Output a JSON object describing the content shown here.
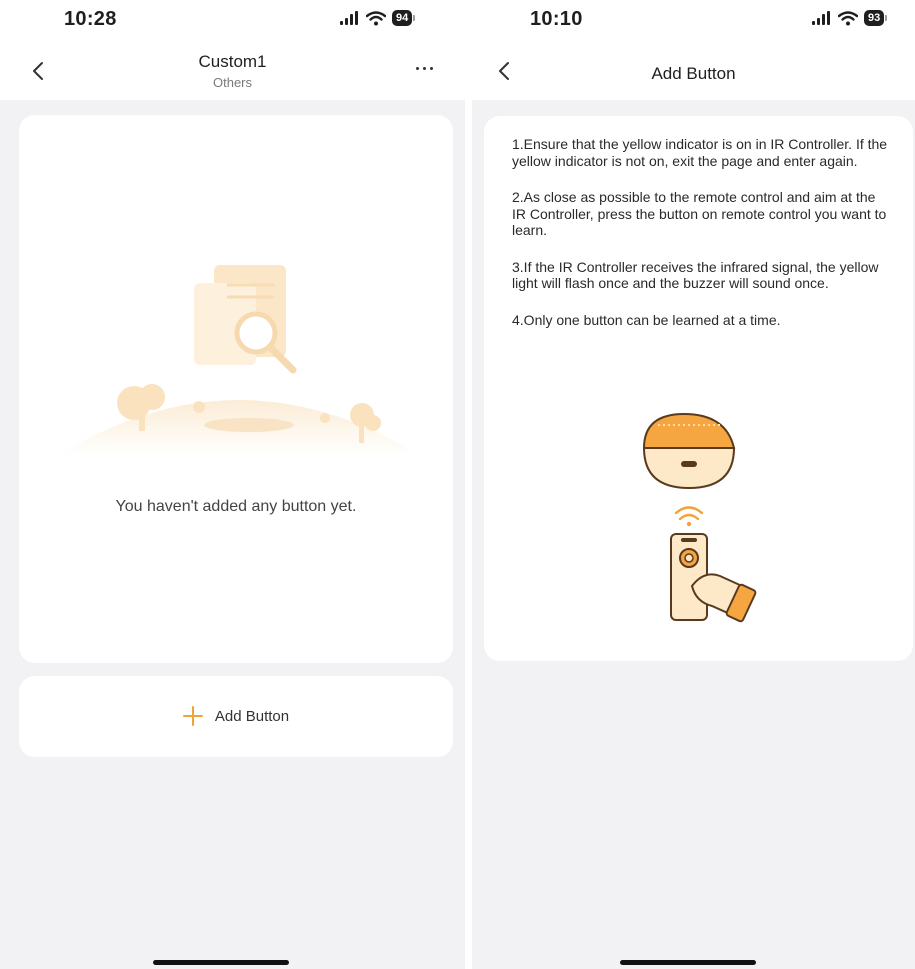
{
  "left": {
    "status": {
      "time": "10:28",
      "battery": "94"
    },
    "nav": {
      "title": "Custom1",
      "subtitle": "Others"
    },
    "empty_message": "You haven't added any button yet.",
    "add_button_label": "Add Button"
  },
  "right": {
    "status": {
      "time": "10:10",
      "battery": "93"
    },
    "nav": {
      "title": "Add Button"
    },
    "steps": [
      "1.Ensure that the yellow indicator is on in IR Controller. If the yellow indicator is not on, exit the page and enter again.",
      "2.As close as possible to the remote control and aim at the IR Controller, press the button on remote control you want to learn.",
      "3.If the IR Controller receives the infrared signal, the yellow light will flash once and the buzzer will sound once.",
      "4.Only one button can be learned at a time."
    ]
  },
  "colors": {
    "accent": "#f0a33a",
    "background": "#f2f2f4",
    "card": "#ffffff"
  },
  "icons": [
    "back-chevron-icon",
    "more-dots-icon",
    "plus-icon",
    "signal-icon",
    "wifi-icon",
    "battery-icon",
    "empty-state-illustration",
    "ir-controller-illustration"
  ]
}
